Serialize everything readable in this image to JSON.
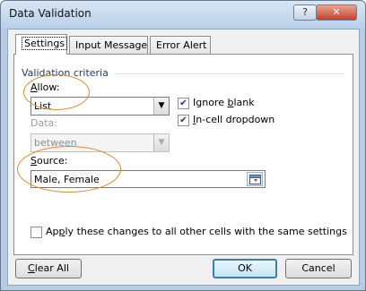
{
  "window": {
    "title": "Data Validation",
    "help_label": "?",
    "close_label": "✕"
  },
  "tabs": [
    {
      "label": "Settings",
      "active": true
    },
    {
      "label": "Input Message",
      "active": false
    },
    {
      "label": "Error Alert",
      "active": false
    }
  ],
  "settings": {
    "group_title": "Validation criteria",
    "allow": {
      "label_accel": "A",
      "label_rest": "llow:",
      "value": "List"
    },
    "ignore_blank": {
      "label_pre": "Ignore ",
      "label_accel": "b",
      "label_post": "lank",
      "checked": true
    },
    "incell_dropdown": {
      "label_accel": "I",
      "label_rest": "n-cell dropdown",
      "checked": true
    },
    "data": {
      "label": "Data:",
      "value": "between",
      "enabled": false
    },
    "source": {
      "label_accel": "S",
      "label_rest": "ource:",
      "value": "Male, Female"
    },
    "apply_all": {
      "label_pre": "Ap",
      "label_accel": "p",
      "label_post": "ly these changes to all other cells with the same settings",
      "checked": false
    }
  },
  "buttons": {
    "clear_accel": "C",
    "clear_rest": "lear All",
    "ok": "OK",
    "cancel": "Cancel"
  },
  "colors": {
    "annotation_circle": "#e08a2e",
    "ok_default_border": "#3c7fb1",
    "group_title": "#1e395b"
  }
}
